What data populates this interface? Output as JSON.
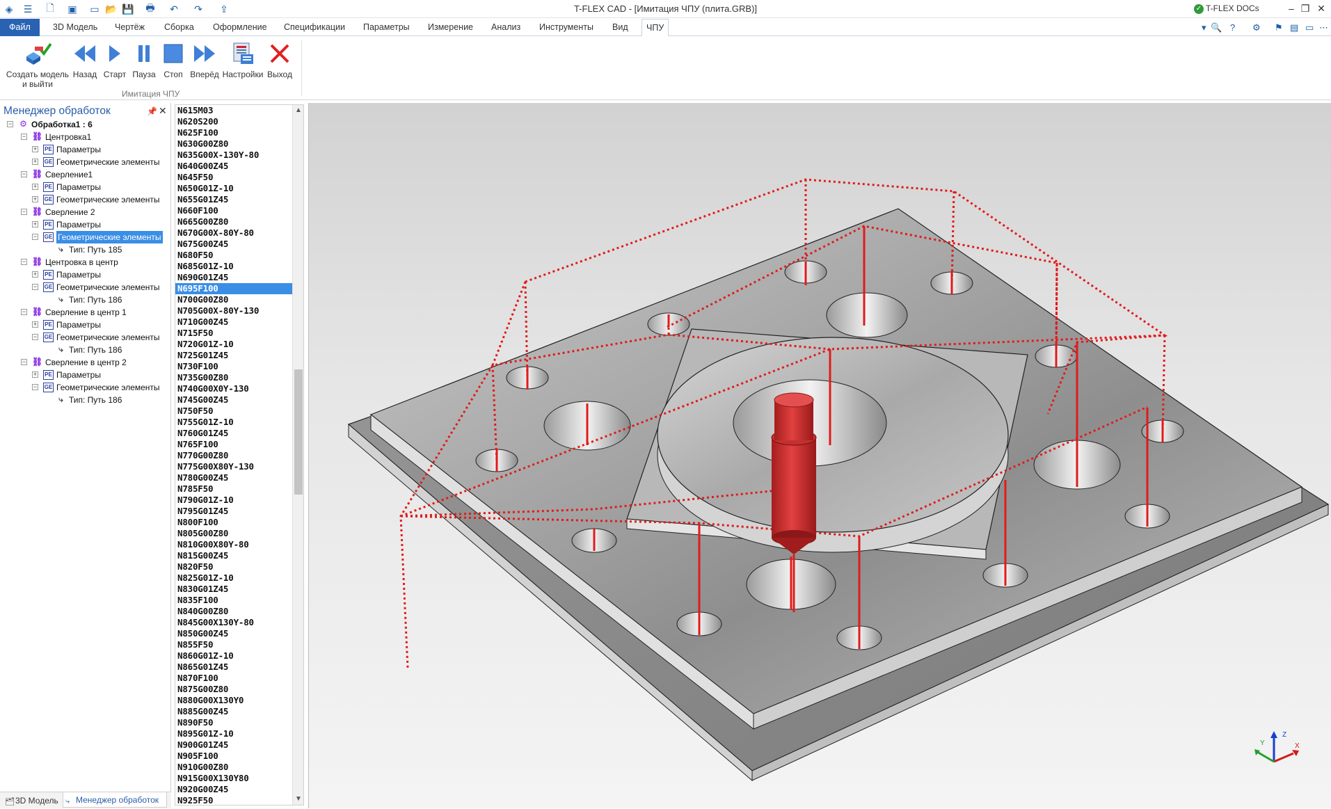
{
  "app": {
    "title": "T-FLEX CAD - [Имитация ЧПУ (плита.GRB)]",
    "docs_label": "T-FLEX DOCs"
  },
  "quick_access": [
    "app-icon",
    "menu-icon",
    "new-icon",
    "cube-icon",
    "window-icon",
    "open-icon",
    "save-icon",
    "print-icon",
    "undo-icon",
    "redo-icon",
    "export-icon"
  ],
  "menu": {
    "file": "Файл",
    "items": [
      "3D Модель",
      "Чертёж",
      "Сборка",
      "Оформление",
      "Спецификации",
      "Параметры",
      "Измерение",
      "Анализ",
      "Инструменты",
      "Вид",
      "ЧПУ"
    ],
    "active": "ЧПУ"
  },
  "ribbon": {
    "buttons": [
      {
        "label1": "Создать модель",
        "label2": "и выйти",
        "icon": "create-model-icon"
      },
      {
        "label1": "Назад",
        "label2": "",
        "icon": "rewind-icon"
      },
      {
        "label1": "Старт",
        "label2": "",
        "icon": "play-icon"
      },
      {
        "label1": "Пауза",
        "label2": "",
        "icon": "pause-icon"
      },
      {
        "label1": "Стоп",
        "label2": "",
        "icon": "stop-icon"
      },
      {
        "label1": "Вперёд",
        "label2": "",
        "icon": "fast-forward-icon"
      },
      {
        "label1": "Настройки",
        "label2": "",
        "icon": "settings-icon"
      },
      {
        "label1": "Выход",
        "label2": "",
        "icon": "exit-icon"
      }
    ],
    "group_label": "Имитация ЧПУ"
  },
  "manager": {
    "title": "Менеджер обработок",
    "root": "Обработка1 : 6",
    "ops": [
      {
        "name": "Центровка1",
        "params": "Параметры",
        "geom": "Геометрические элементы",
        "path": ""
      },
      {
        "name": "Сверление1",
        "params": "Параметры",
        "geom": "Геометрические элементы",
        "path": ""
      },
      {
        "name": "Сверление 2",
        "params": "Параметры",
        "geom": "Геометрические элементы",
        "path": "Тип: Путь 185"
      },
      {
        "name": "Центровка в центр",
        "params": "Параметры",
        "geom": "Геометрические элементы",
        "path": "Тип: Путь 186"
      },
      {
        "name": "Сверление в центр 1",
        "params": "Параметры",
        "geom": "Геометрические элементы",
        "path": "Тип: Путь 186"
      },
      {
        "name": "Сверление в центр 2",
        "params": "Параметры",
        "geom": "Геометрические элементы",
        "path": "Тип: Путь 186"
      }
    ],
    "selected_geom_index": 2
  },
  "bottom_tabs": [
    "3D Модель",
    "Менеджер обработок"
  ],
  "nc_code": {
    "lines": [
      "N615M03",
      "N620S200",
      "N625F100",
      "N630G00Z80",
      "N635G00X-130Y-80",
      "N640G00Z45",
      "N645F50",
      "N650G01Z-10",
      "N655G01Z45",
      "N660F100",
      "N665G00Z80",
      "N670G00X-80Y-80",
      "N675G00Z45",
      "N680F50",
      "N685G01Z-10",
      "N690G01Z45",
      "N695F100",
      "N700G00Z80",
      "N705G00X-80Y-130",
      "N710G00Z45",
      "N715F50",
      "N720G01Z-10",
      "N725G01Z45",
      "N730F100",
      "N735G00Z80",
      "N740G00X0Y-130",
      "N745G00Z45",
      "N750F50",
      "N755G01Z-10",
      "N760G01Z45",
      "N765F100",
      "N770G00Z80",
      "N775G00X80Y-130",
      "N780G00Z45",
      "N785F50",
      "N790G01Z-10",
      "N795G01Z45",
      "N800F100",
      "N805G00Z80",
      "N810G00X80Y-80",
      "N815G00Z45",
      "N820F50",
      "N825G01Z-10",
      "N830G01Z45",
      "N835F100",
      "N840G00Z80",
      "N845G00X130Y-80",
      "N850G00Z45",
      "N855F50",
      "N860G01Z-10",
      "N865G01Z45",
      "N870F100",
      "N875G00Z80",
      "N880G00X130Y0",
      "N885G00Z45",
      "N890F50",
      "N895G01Z-10",
      "N900G01Z45",
      "N905F100",
      "N910G00Z80",
      "N915G00X130Y80",
      "N920G00Z45",
      "N925F50"
    ],
    "selected": "N695F100"
  },
  "triad": {
    "x": "X",
    "y": "Y",
    "z": "Z"
  }
}
